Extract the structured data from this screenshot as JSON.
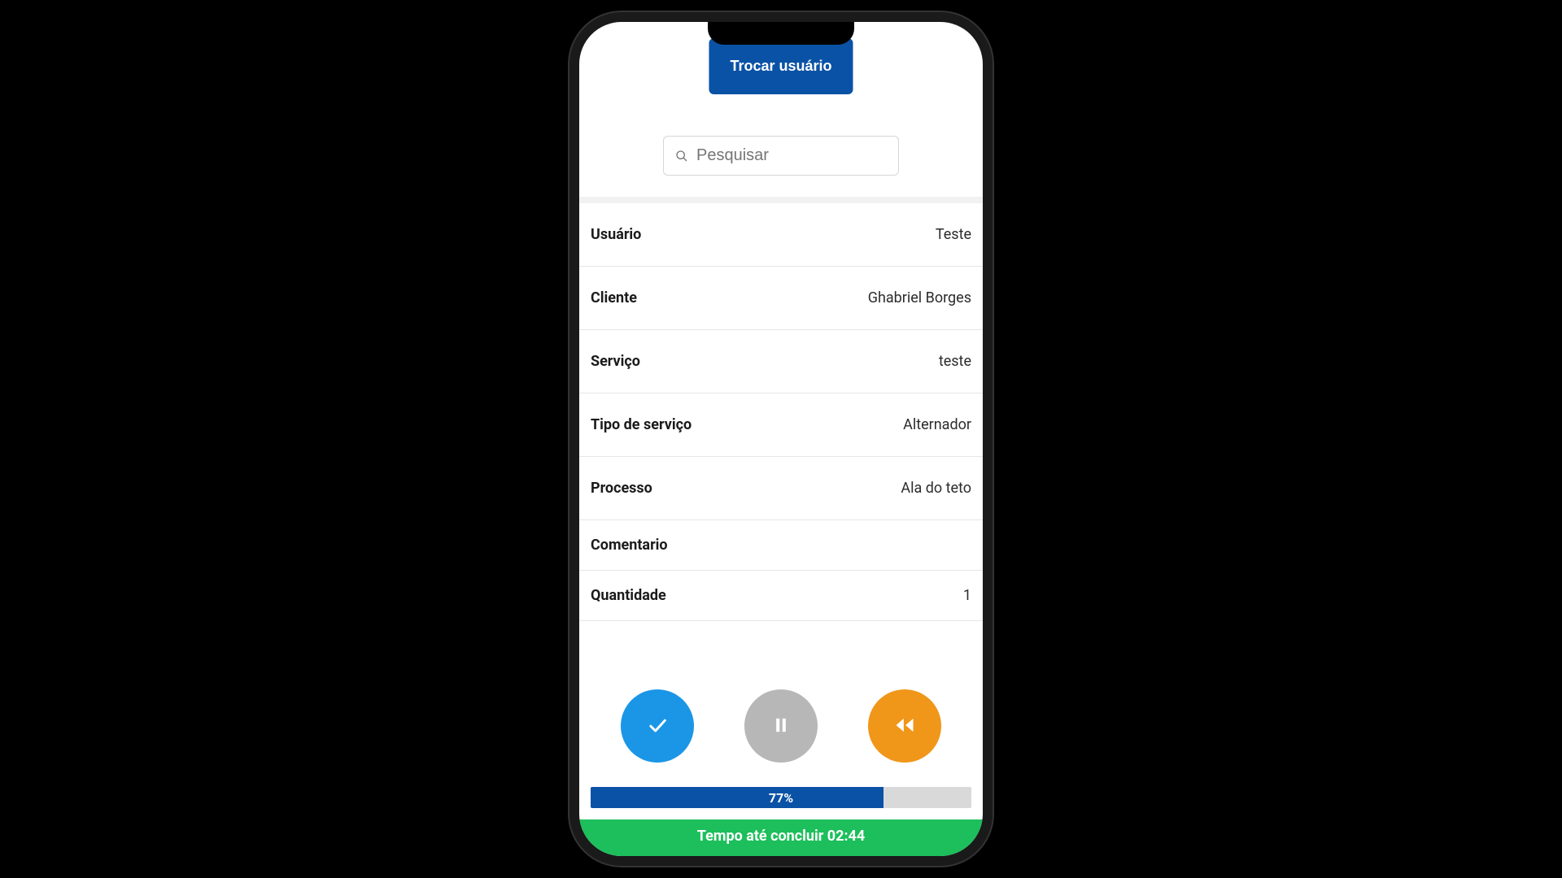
{
  "header": {
    "switch_user_label": "Trocar usuário"
  },
  "search": {
    "placeholder": "Pesquisar"
  },
  "fields": {
    "user": {
      "label": "Usuário",
      "value": "Teste"
    },
    "client": {
      "label": "Cliente",
      "value": "Ghabriel Borges"
    },
    "service": {
      "label": "Serviço",
      "value": "teste"
    },
    "service_type": {
      "label": "Tipo de serviço",
      "value": "Alternador"
    },
    "process": {
      "label": "Processo",
      "value": "Ala do teto"
    },
    "comment": {
      "label": "Comentario",
      "value": ""
    },
    "quantity": {
      "label": "Quantidade",
      "value": "1"
    }
  },
  "icons": {
    "confirm": "check-icon",
    "pause": "pause-icon",
    "rewind": "rewind-icon",
    "search": "search-icon"
  },
  "progress": {
    "percent_label": "77%",
    "percent_value": 77
  },
  "timer": {
    "label": "Tempo até concluir 02:44"
  }
}
